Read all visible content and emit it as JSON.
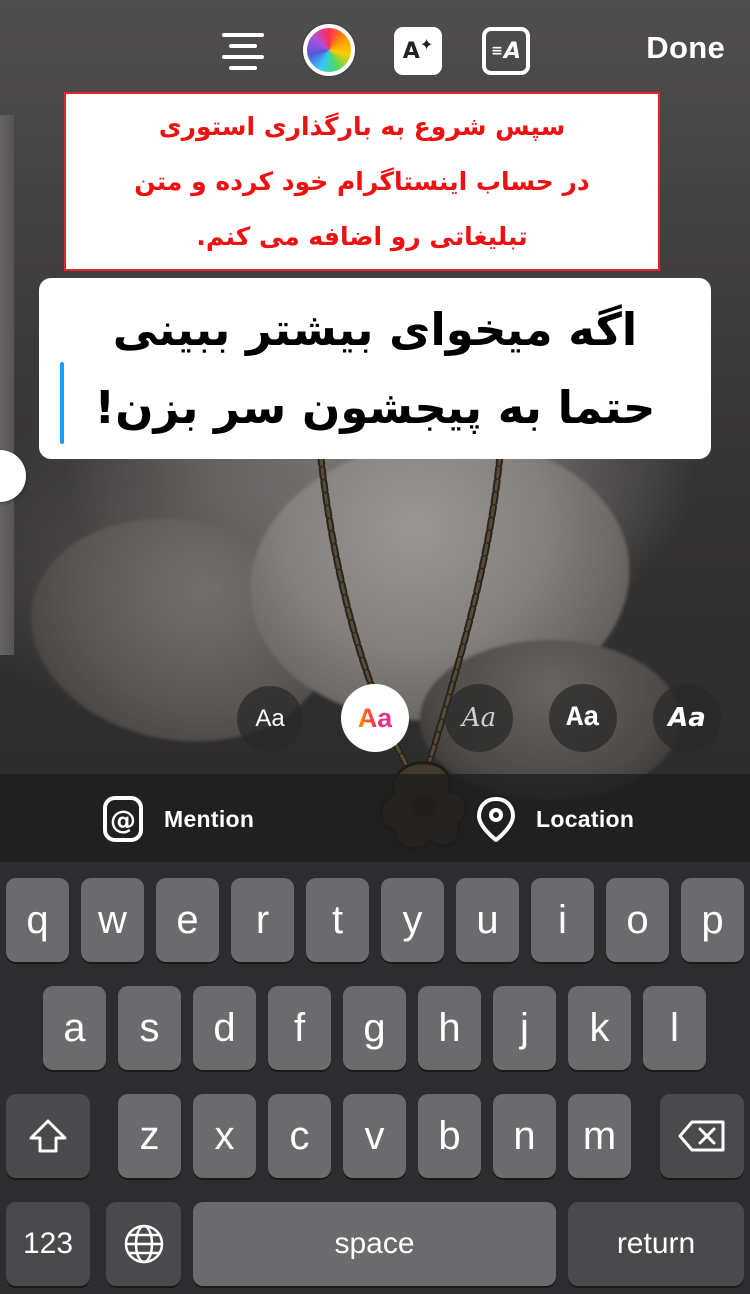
{
  "toolbar": {
    "done_label": "Done",
    "effects_icon_text": "A",
    "animate_icon_text": "A",
    "icons": [
      "text-align-icon",
      "color-wheel-icon",
      "text-effects-icon",
      "text-animation-icon"
    ]
  },
  "annotation": {
    "lines": [
      "سپس شروع به بارگذاری استوری",
      "در حساب اینستاگرام خود کرده و متن",
      "تبلیغاتی رو اضافه می کنم."
    ],
    "color": "#ee1111"
  },
  "story_text": {
    "lines": [
      "اگه میخوای بیشتر ببینی",
      "حتما به پیجشون سر بزن!"
    ],
    "background": "#ffffff",
    "color": "#000000"
  },
  "font_styles": [
    {
      "id": "classic",
      "label": "Aa"
    },
    {
      "id": "modern",
      "label": "Aa",
      "selected": true
    },
    {
      "id": "neon",
      "label": "Aa"
    },
    {
      "id": "typewriter",
      "label": "Aa"
    },
    {
      "id": "strong",
      "label": "Aa"
    }
  ],
  "stickers": {
    "mention_label": "Mention",
    "location_label": "Location"
  },
  "keyboard": {
    "row1": [
      "q",
      "w",
      "e",
      "r",
      "t",
      "y",
      "u",
      "i",
      "o",
      "p"
    ],
    "row2": [
      "a",
      "s",
      "d",
      "f",
      "g",
      "h",
      "j",
      "k",
      "l"
    ],
    "row3": [
      "z",
      "x",
      "c",
      "v",
      "b",
      "n",
      "m"
    ],
    "numbers_label": "123",
    "space_label": "space",
    "return_label": "return"
  }
}
